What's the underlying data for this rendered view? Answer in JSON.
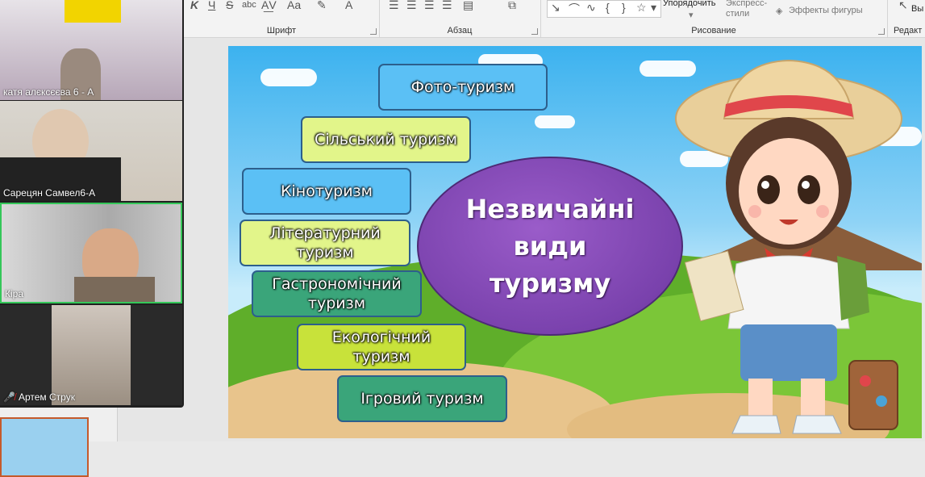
{
  "ribbon": {
    "groups": [
      {
        "label": "Шрифт"
      },
      {
        "label": "Абзац"
      },
      {
        "label": "Рисование"
      },
      {
        "label": "Редакт"
      }
    ],
    "arrange_label": "Упорядочить",
    "quick_styles_label": "Экспресс-стили",
    "shape_effects_label": "Эффекты фигуры",
    "select_label": "Вы"
  },
  "participants": [
    {
      "name": "катя алєксєєва 6 - А",
      "muted": false
    },
    {
      "name": "Сарецян Самвел6-А",
      "muted": false
    },
    {
      "name": "Кіра",
      "muted": false,
      "active": true
    },
    {
      "name": "Артем Струк",
      "muted": true
    }
  ],
  "slide": {
    "center_title": "Незвичайні види туризму",
    "center_lines": [
      "Незвичайні",
      "види",
      "туризму"
    ],
    "boxes": [
      {
        "text": "Фото-туризм",
        "color": "#5bc0f5"
      },
      {
        "text": "Сільський туризм",
        "color": "#e2f58a"
      },
      {
        "text": "Кінотуризм",
        "color": "#5bc0f5"
      },
      {
        "text": "Літературний туризм",
        "color": "#e2f58a"
      },
      {
        "text": "Гастрономічний туризм",
        "color": "#3aa57a"
      },
      {
        "text": "Екологічний туризм",
        "color": "#c8e23a"
      },
      {
        "text": "Ігровий туризм",
        "color": "#3aa57a"
      }
    ]
  }
}
